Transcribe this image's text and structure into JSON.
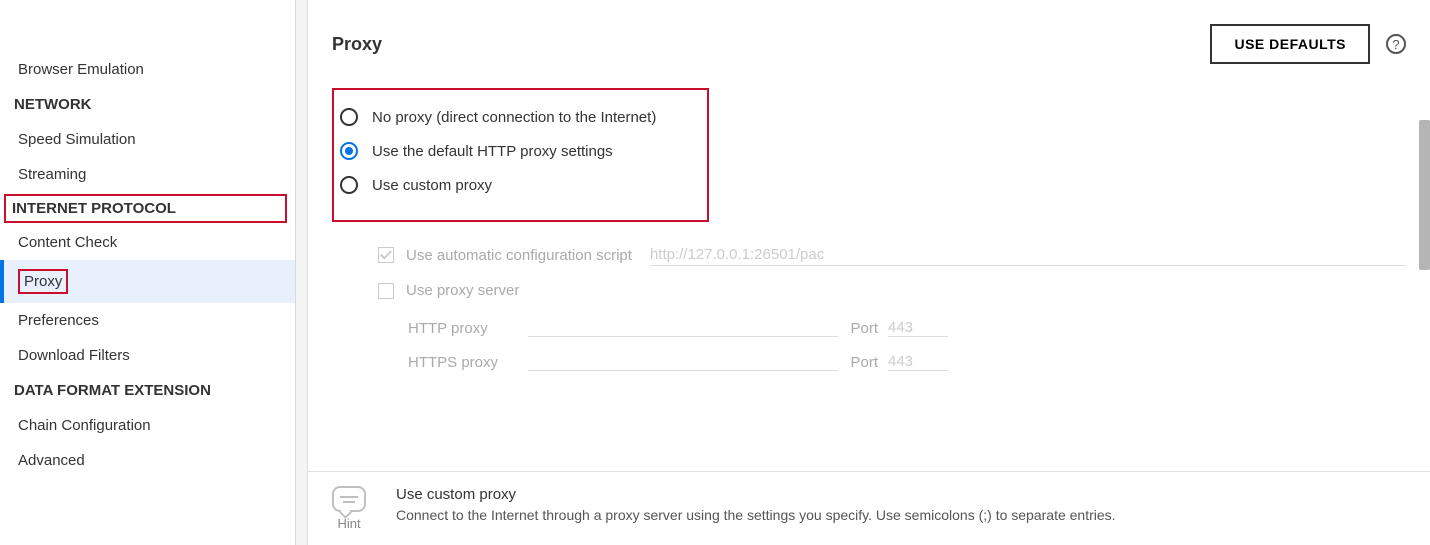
{
  "sidebar": {
    "items": [
      {
        "label": "Browser Emulation",
        "type": "item"
      },
      {
        "label": "NETWORK",
        "type": "header"
      },
      {
        "label": "Speed Simulation",
        "type": "item"
      },
      {
        "label": "Streaming",
        "type": "item"
      },
      {
        "label": "INTERNET PROTOCOL",
        "type": "header",
        "highlight": true
      },
      {
        "label": "Content Check",
        "type": "item"
      },
      {
        "label": "Proxy",
        "type": "item",
        "active": true,
        "highlight": true
      },
      {
        "label": "Preferences",
        "type": "item"
      },
      {
        "label": "Download Filters",
        "type": "item"
      },
      {
        "label": "DATA FORMAT EXTENSION",
        "type": "header"
      },
      {
        "label": "Chain Configuration",
        "type": "item"
      },
      {
        "label": "Advanced",
        "type": "item"
      }
    ]
  },
  "main": {
    "title": "Proxy",
    "use_defaults": "USE DEFAULTS",
    "help_glyph": "?",
    "radios": {
      "no_proxy": "No proxy (direct connection to the Internet)",
      "default_proxy": "Use the default HTTP proxy settings",
      "custom_proxy": "Use custom proxy",
      "selected": "default_proxy"
    },
    "custom": {
      "auto_config_label": "Use automatic configuration script",
      "auto_config_value": "http://127.0.0.1:26501/pac",
      "use_proxy_server": "Use proxy server",
      "http_label": "HTTP proxy",
      "https_label": "HTTPS proxy",
      "port_label": "Port",
      "http_port": "443",
      "https_port": "443"
    },
    "hint": {
      "caption": "Hint",
      "title": "Use custom proxy",
      "desc": "Connect to the Internet through a proxy server using the settings you specify. Use semicolons (;) to separate entries."
    }
  }
}
